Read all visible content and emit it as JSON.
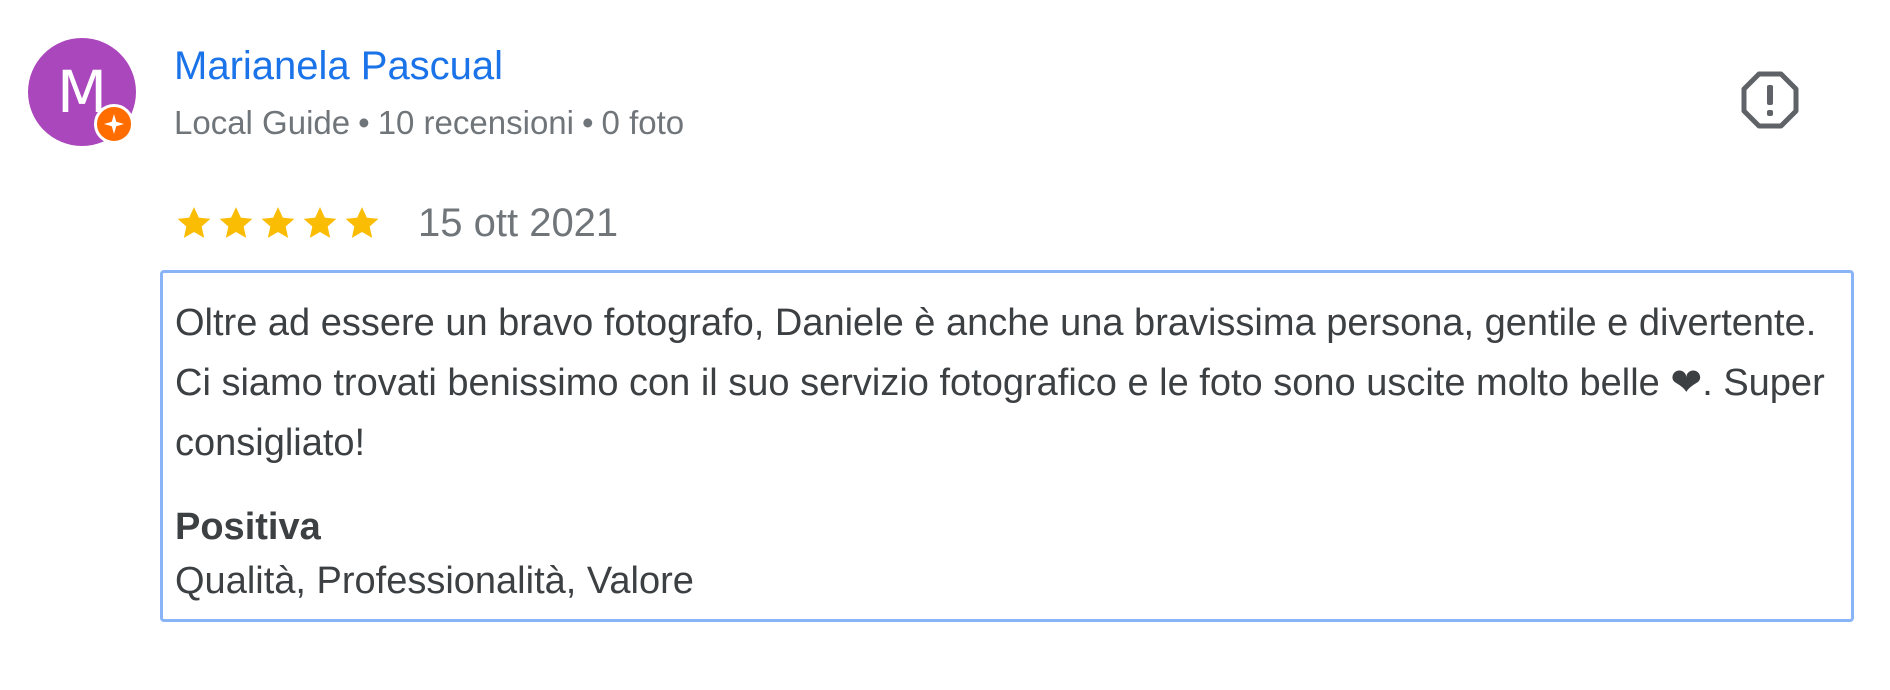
{
  "reviewer": {
    "avatar_initial": "M",
    "avatar_color": "#ab47bc",
    "badge_color": "#ff6d00",
    "name": "Marianela Pascual",
    "guide_label": "Local Guide",
    "reviews_count": "10 recensioni",
    "photos_count": "0 foto",
    "separator": "•"
  },
  "review": {
    "rating": 5,
    "max_rating": 5,
    "star_color": "#fbbc04",
    "date": "15 ott 2021",
    "text_part1": "Oltre ad essere un bravo fotografo, Daniele è anche una bravissima persona, gentile e divertente. Ci siamo trovati benissimo con il suo servizio fotografico e le foto sono uscite molto belle ",
    "heart": "❤",
    "text_part2": ". Super consigliato!",
    "positive_title": "Positiva",
    "positive_values": "Qualità, Professionalità, Valore"
  },
  "icons": {
    "report": "report-flag-icon",
    "star": "star-icon",
    "guide": "local-guide-badge-icon"
  },
  "colors": {
    "name_link": "#1a73e8",
    "meta_text": "#70757a",
    "focus_border": "#8ab4f8"
  }
}
